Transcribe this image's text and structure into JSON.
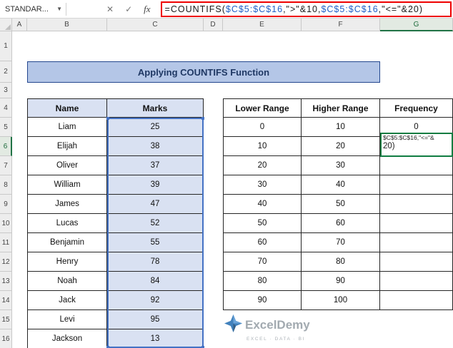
{
  "formula_bar": {
    "name_box_value": "STANDAR...",
    "cancel_icon": "✕",
    "enter_icon": "✓",
    "fx_icon": "fx",
    "formula": "=COUNTIFS($C$5:$C$16,\">\"&10,$C$5:$C$16,\"<=\"&20)",
    "formula_parts": [
      {
        "text": "=COUNTIFS(",
        "color": "#1a1a1a"
      },
      {
        "text": "$C$5:$C$16",
        "color": "#2060c8"
      },
      {
        "text": ",\">\"&10,",
        "color": "#1a1a1a"
      },
      {
        "text": "$C$5:$C$16",
        "color": "#2060c8"
      },
      {
        "text": ",\"<=\"&20)",
        "color": "#1a1a1a"
      }
    ]
  },
  "sheet": {
    "columns": [
      "A",
      "B",
      "C",
      "D",
      "E",
      "F",
      "G"
    ],
    "active_column": "G",
    "active_row": 6,
    "row_count": 16
  },
  "banner": {
    "title": "Applying COUNTIFS Function"
  },
  "tables": {
    "marks": {
      "headers": [
        "Name",
        "Marks"
      ],
      "rows": [
        {
          "name": "Liam",
          "marks": 25
        },
        {
          "name": "Elijah",
          "marks": 38
        },
        {
          "name": "Oliver",
          "marks": 37
        },
        {
          "name": "William",
          "marks": 39
        },
        {
          "name": "James",
          "marks": 47
        },
        {
          "name": "Lucas",
          "marks": 52
        },
        {
          "name": "Benjamin",
          "marks": 55
        },
        {
          "name": "Henry",
          "marks": 78
        },
        {
          "name": "Noah",
          "marks": 84
        },
        {
          "name": "Jack",
          "marks": 92
        },
        {
          "name": "Levi",
          "marks": 95
        },
        {
          "name": "Jackson",
          "marks": 13
        }
      ]
    },
    "ranges": {
      "headers": [
        "Lower Range",
        "Higher Range",
        "Frequency"
      ],
      "rows": [
        {
          "lower": 0,
          "higher": 10,
          "frequency": "0"
        },
        {
          "lower": 10,
          "higher": 20,
          "frequency": ""
        },
        {
          "lower": 20,
          "higher": 30,
          "frequency": ""
        },
        {
          "lower": 30,
          "higher": 40,
          "frequency": ""
        },
        {
          "lower": 40,
          "higher": 50,
          "frequency": ""
        },
        {
          "lower": 50,
          "higher": 60,
          "frequency": ""
        },
        {
          "lower": 60,
          "higher": 70,
          "frequency": ""
        },
        {
          "lower": 70,
          "higher": 80,
          "frequency": ""
        },
        {
          "lower": 80,
          "higher": 90,
          "frequency": ""
        },
        {
          "lower": 90,
          "higher": 100,
          "frequency": ""
        }
      ]
    }
  },
  "editing": {
    "cell": "G6",
    "overflow_line1": "$C$5:$C$16,\"<=\"&",
    "overflow_line2": "20)"
  },
  "watermark": {
    "brand": "ExcelDemy",
    "tagline": "EXCEL · DATA · BI"
  },
  "colors": {
    "banner_bg": "#B4C6E7",
    "banner_text": "#1F3864",
    "table_header_bg": "#D9E1F2",
    "selection_border": "#4472C4",
    "edit_border": "#107C41",
    "formula_box_border": "#EE0000"
  }
}
